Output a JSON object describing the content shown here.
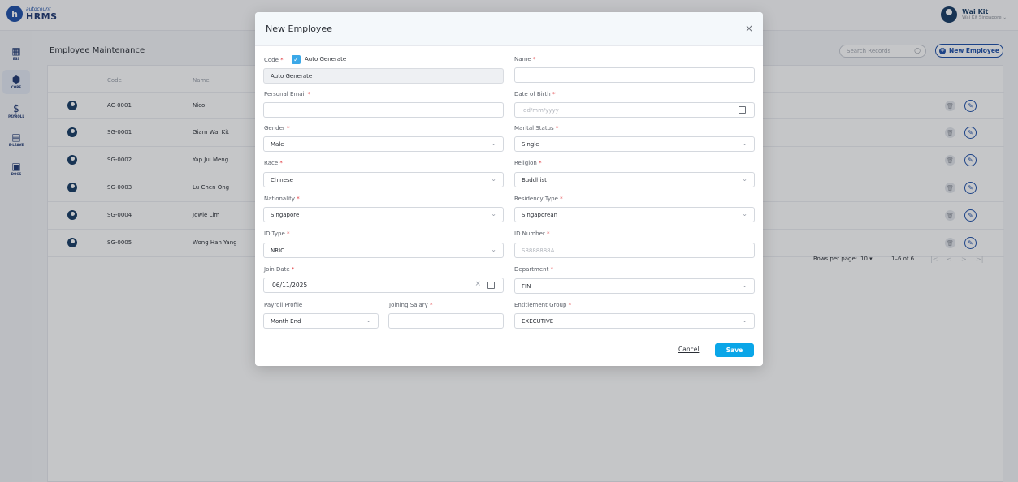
{
  "app": {
    "logo_small": "autocount",
    "logo_big": "HRMS",
    "logo_badge": "h"
  },
  "user": {
    "name": "Wai Kit",
    "subtitle": "Wai Kit Singapore ⌄"
  },
  "sidebar": {
    "items": [
      {
        "label": "ESS",
        "icon": "grid-icon",
        "glyph": "▦"
      },
      {
        "label": "CORE",
        "icon": "cube-icon",
        "glyph": "⬢"
      },
      {
        "label": "PAYROLL",
        "icon": "dollar-icon",
        "glyph": "$"
      },
      {
        "label": "E-LEAVE",
        "icon": "calendar-icon",
        "glyph": "▤"
      },
      {
        "label": "DOCS",
        "icon": "document-icon",
        "glyph": "▣"
      }
    ]
  },
  "page": {
    "title": "Employee Maintenance",
    "search_placeholder": "Search Records",
    "new_button": "New Employee"
  },
  "table": {
    "columns": [
      "Code",
      "Name"
    ],
    "rows": [
      {
        "code": "AC-0001",
        "name": "Nicol"
      },
      {
        "code": "SG-0001",
        "name": "Giam Wai Kit"
      },
      {
        "code": "SG-0002",
        "name": "Yap Jui Meng"
      },
      {
        "code": "SG-0003",
        "name": "Lu Chen Ong"
      },
      {
        "code": "SG-0004",
        "name": "Jowie Lim"
      },
      {
        "code": "SG-0005",
        "name": "Wong Han Yang"
      }
    ],
    "rows_per_page_label": "Rows per page:",
    "rows_per_page_value": "10 ▾",
    "range": "1–6 of 6",
    "nav_first": "|<",
    "nav_prev": "<",
    "nav_next": ">",
    "nav_last": ">|"
  },
  "modal": {
    "title": "New Employee",
    "close": "×",
    "auto_generate_label": "Auto Generate",
    "req_mark": "*",
    "fields": {
      "code": {
        "label": "Code",
        "value": "Auto Generate"
      },
      "name": {
        "label": "Name",
        "value": ""
      },
      "personal_email": {
        "label": "Personal Email",
        "value": ""
      },
      "date_of_birth": {
        "label": "Date of Birth",
        "placeholder": "dd/mm/yyyy"
      },
      "gender": {
        "label": "Gender",
        "value": "Male"
      },
      "marital_status": {
        "label": "Marital Status",
        "value": "Single"
      },
      "race": {
        "label": "Race",
        "value": "Chinese"
      },
      "religion": {
        "label": "Religion",
        "value": "Buddhist"
      },
      "nationality": {
        "label": "Nationality",
        "value": "Singapore"
      },
      "residency_type": {
        "label": "Residency Type",
        "value": "Singaporean"
      },
      "id_type": {
        "label": "ID Type",
        "value": "NRIC"
      },
      "id_number": {
        "label": "ID Number",
        "placeholder": "S8888888A"
      },
      "join_date": {
        "label": "Join Date",
        "value": "06/11/2025"
      },
      "department": {
        "label": "Department",
        "value": "FIN"
      },
      "payroll_profile": {
        "label": "Payroll Profile",
        "value": "Month End"
      },
      "joining_salary": {
        "label": "Joining Salary",
        "value": ""
      },
      "entitlement_group": {
        "label": "Entitlement Group",
        "value": "EXECUTIVE"
      }
    },
    "cancel": "Cancel",
    "save": "Save"
  },
  "colors": {
    "primary": "#1d4fa8",
    "save": "#0aa6e8",
    "required": "#e0393e",
    "checkbox": "#3aa8e8"
  }
}
